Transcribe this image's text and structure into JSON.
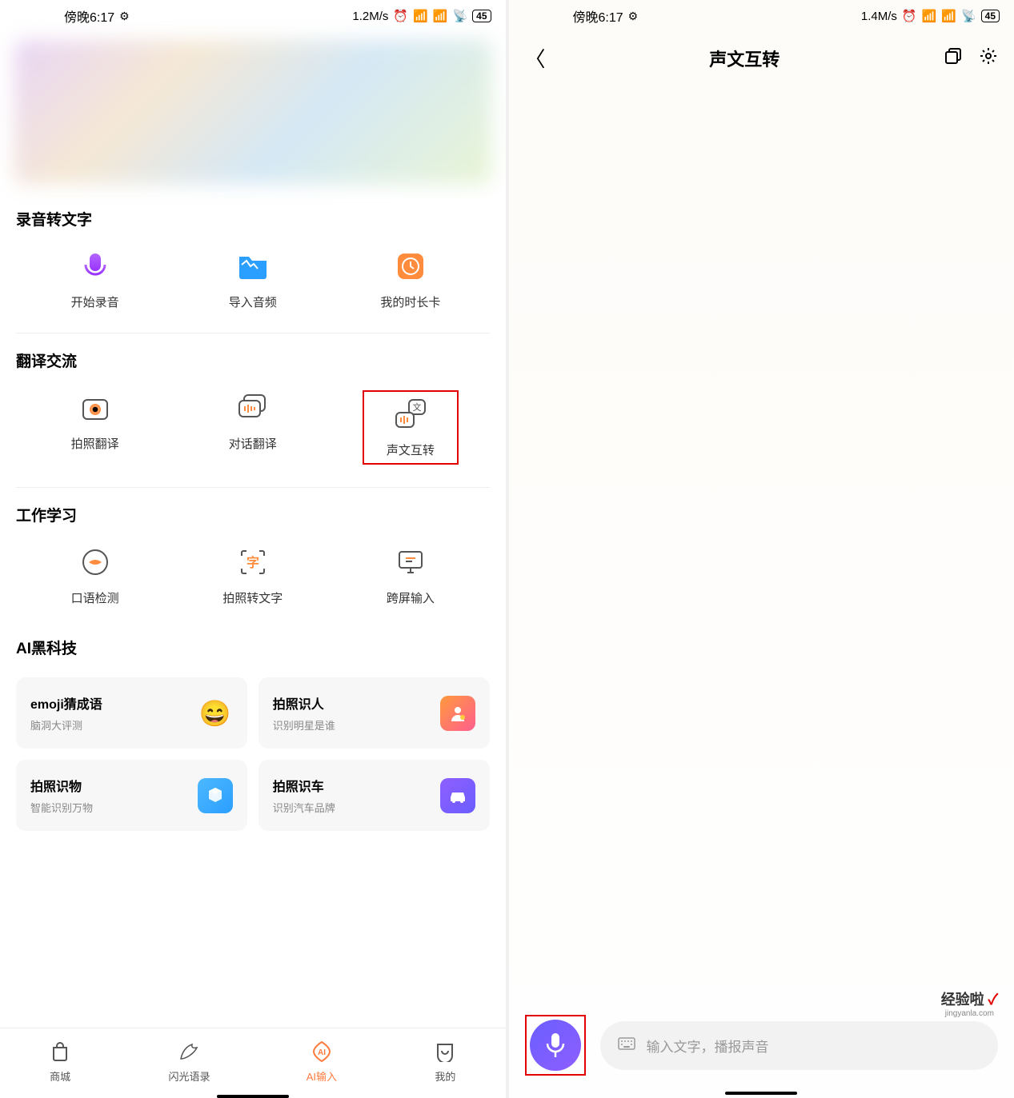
{
  "left": {
    "status": {
      "time": "傍晚6:17",
      "speed": "1.2M/s",
      "battery": "45"
    },
    "sections": {
      "s1": {
        "title": "录音转文字",
        "items": [
          "开始录音",
          "导入音频",
          "我的时长卡"
        ]
      },
      "s2": {
        "title": "翻译交流",
        "items": [
          "拍照翻译",
          "对话翻译",
          "声文互转"
        ]
      },
      "s3": {
        "title": "工作学习",
        "items": [
          "口语检测",
          "拍照转文字",
          "跨屏输入"
        ]
      },
      "s4": {
        "title": "AI黑科技"
      }
    },
    "ai_cards": [
      {
        "title": "emoji猜成语",
        "sub": "脑洞大评测"
      },
      {
        "title": "拍照识人",
        "sub": "识别明星是谁"
      },
      {
        "title": "拍照识物",
        "sub": "智能识别万物"
      },
      {
        "title": "拍照识车",
        "sub": "识别汽车品牌"
      }
    ],
    "nav": [
      "商城",
      "闪光语录",
      "AI输入",
      "我的"
    ]
  },
  "right": {
    "status": {
      "time": "傍晚6:17",
      "speed": "1.4M/s",
      "battery": "45"
    },
    "title": "声文互转",
    "input_placeholder": "输入文字，播报声音"
  },
  "watermark": {
    "main": "经验啦",
    "sub": "jingyanla.com"
  }
}
